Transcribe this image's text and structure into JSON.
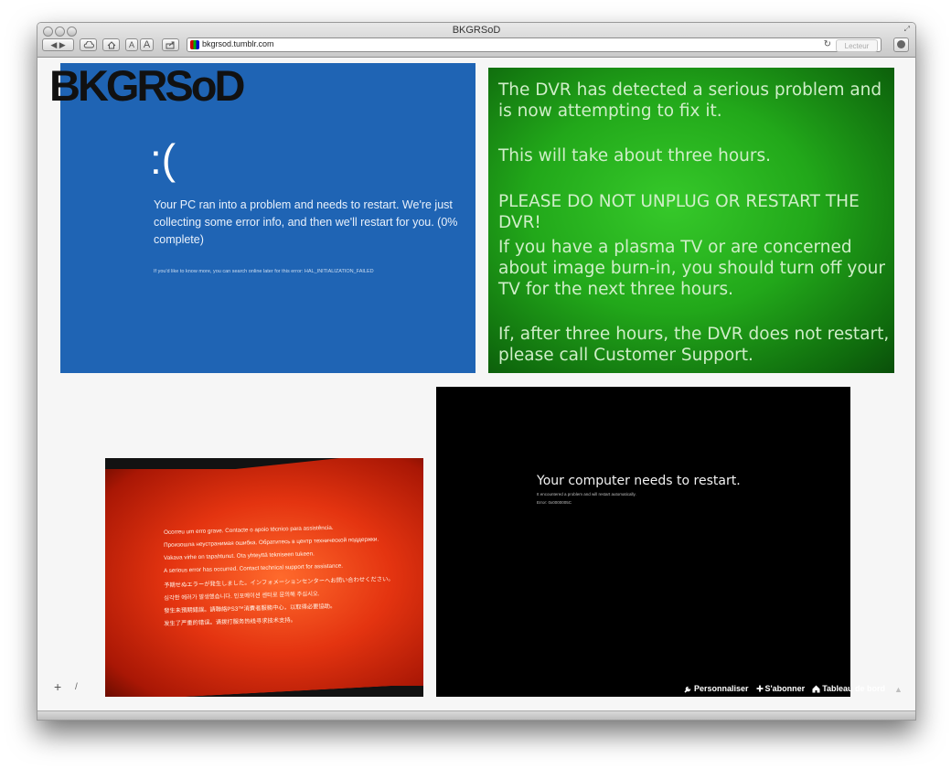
{
  "window": {
    "title": "BKGRSoD"
  },
  "toolbar": {
    "url": "bkgrsod.tumblr.com",
    "reader_label": "Lecteur",
    "text_smaller": "A",
    "text_larger": "A"
  },
  "blog": {
    "logo": "BKGRSoD"
  },
  "posts": {
    "win8": {
      "face": ":(",
      "message": "Your PC ran into a problem and needs to restart. We're just collecting some error info, and then we'll restart for you. (0% complete)",
      "small": "If you'd like to know more, you can search online later for this error: HAL_INITIALIZATION_FAILED"
    },
    "dvr": {
      "lines": [
        "The DVR has detected a serious problem and is now attempting to fix it.",
        "This will take about three hours.",
        "PLEASE DO NOT UNPLUG OR RESTART THE DVR!",
        "If you have a plasma TV or are concerned about image burn-in, you should turn off your TV for the next three hours.",
        "If, after three hours, the DVR does not restart, please call Customer Support."
      ]
    },
    "ps3": {
      "lines": [
        "Ocorreu um erro grave. Contacte o apoio técnico para assistência.",
        "Произошла неустранимая ошибка. Обратитесь в центр технической поддержки.",
        "Vakava virhe on tapahtunut. Ota yhteyttä tekniseen tukeen.",
        "A serious error has occurred. Contact technical support for assistance.",
        "予期せぬエラーが発生しました。インフォメーションセンターへお問い合わせください。",
        "심각한 에러가 발생했습니다. 인포메이션 센터로 문의해 주십시오.",
        "發生未預期錯誤。請聯絡PS3™消費者服務中心，以取得必要協助。",
        "发生了严重的错误。请拨打服务热线寻求技术支持。"
      ]
    },
    "restart": {
      "title": "Your computer needs to restart.",
      "sub": "It encountered a problem and will restart automatically.",
      "error": "Error: 0x0000005C"
    }
  },
  "tumblr": {
    "customize": "Personnaliser",
    "follow": "S'abonner",
    "dashboard": "Tableau de bord"
  },
  "nav": {
    "plus": "+",
    "slash": "/"
  }
}
